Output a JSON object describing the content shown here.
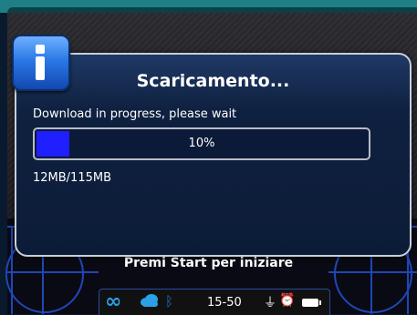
{
  "dialog": {
    "title": "Scaricamento...",
    "message": "Download in progress, please wait",
    "progress_label": "10%",
    "progress_value": 0.1,
    "size_text": "12MB/115MB"
  },
  "screen": {
    "hint": "Premi Start per iniziare"
  },
  "status_bar": {
    "time": "15-50"
  },
  "icons": {
    "info": "info-icon",
    "cloud": "cloud-icon",
    "bluetooth": "bluetooth-icon",
    "plug": "plug-icon",
    "alarm": "alarm-clock-icon",
    "battery": "battery-icon"
  },
  "colors": {
    "progress_fill": "#1f1fff",
    "dialog_border": "#c9ced8",
    "grid": "#1e47b8"
  }
}
